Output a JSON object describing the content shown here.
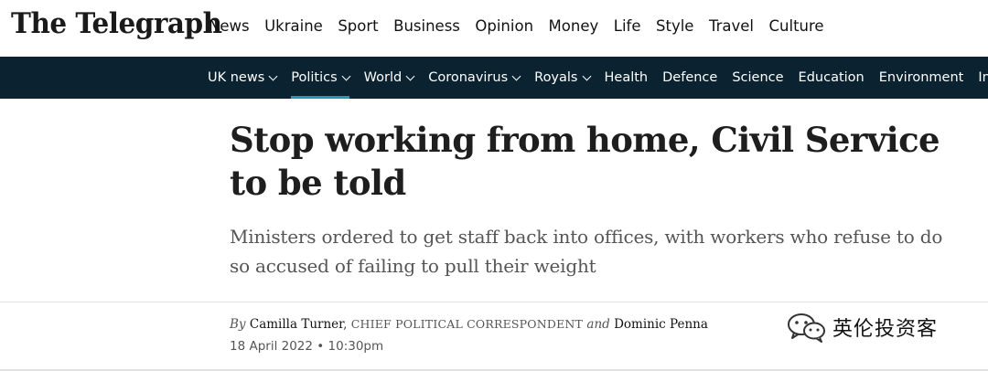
{
  "masthead": {
    "logo_text": "The Telegraph",
    "nav": [
      "News",
      "Ukraine",
      "Sport",
      "Business",
      "Opinion",
      "Money",
      "Life",
      "Style",
      "Travel",
      "Culture"
    ]
  },
  "subnav": {
    "items": [
      {
        "label": "UK news",
        "dropdown": true,
        "active": false
      },
      {
        "label": "Politics",
        "dropdown": true,
        "active": true
      },
      {
        "label": "World",
        "dropdown": true,
        "active": false
      },
      {
        "label": "Coronavirus",
        "dropdown": true,
        "active": false
      },
      {
        "label": "Royals",
        "dropdown": true,
        "active": false
      },
      {
        "label": "Health",
        "dropdown": false,
        "active": false
      },
      {
        "label": "Defence",
        "dropdown": false,
        "active": false
      },
      {
        "label": "Science",
        "dropdown": false,
        "active": false
      },
      {
        "label": "Education",
        "dropdown": false,
        "active": false
      },
      {
        "label": "Environment",
        "dropdown": false,
        "active": false
      },
      {
        "label": "Investiga",
        "dropdown": false,
        "active": false
      }
    ],
    "background_color": "#0b2230",
    "active_underline_color": "#1d9bb5"
  },
  "article": {
    "headline": "Stop working from home, Civil Service to be told",
    "standfirst": "Ministers ordered to get staff back into offices, with workers who refuse to do so accused of failing to pull their weight",
    "byline": {
      "by": "By",
      "author1": "Camilla Turner",
      "role": "Chief Political Correspondent",
      "and": "and",
      "author2": "Dominic Penna"
    },
    "date": "18 April 2022 • 10:30pm"
  },
  "watermark": {
    "text": "英伦投资客",
    "icon": "wechat-icon"
  }
}
